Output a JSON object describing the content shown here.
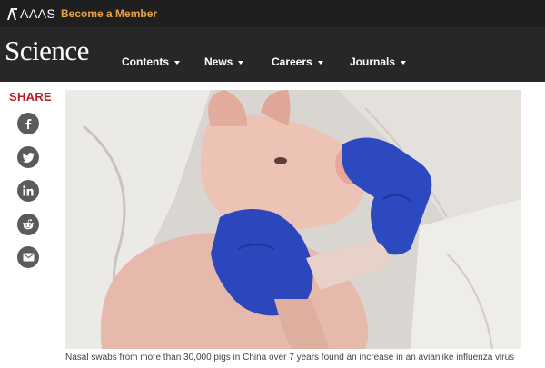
{
  "topbar": {
    "logo_text": "AAAS",
    "member_link": "Become a Member",
    "accent_color": "#e9a24a"
  },
  "header": {
    "wordmark": "Science",
    "nav": [
      {
        "label": "Contents"
      },
      {
        "label": "News"
      },
      {
        "label": "Careers"
      },
      {
        "label": "Journals"
      }
    ]
  },
  "share": {
    "label": "SHARE",
    "label_color": "#b81d24",
    "buttons": [
      {
        "icon": "facebook-icon"
      },
      {
        "icon": "twitter-icon"
      },
      {
        "icon": "linkedin-icon"
      },
      {
        "icon": "reddit-icon"
      },
      {
        "icon": "email-icon"
      }
    ]
  },
  "article": {
    "caption": "Nasal swabs from more than 30,000 pigs in China over 7 years found an increase in an avianlike influenza virus"
  }
}
